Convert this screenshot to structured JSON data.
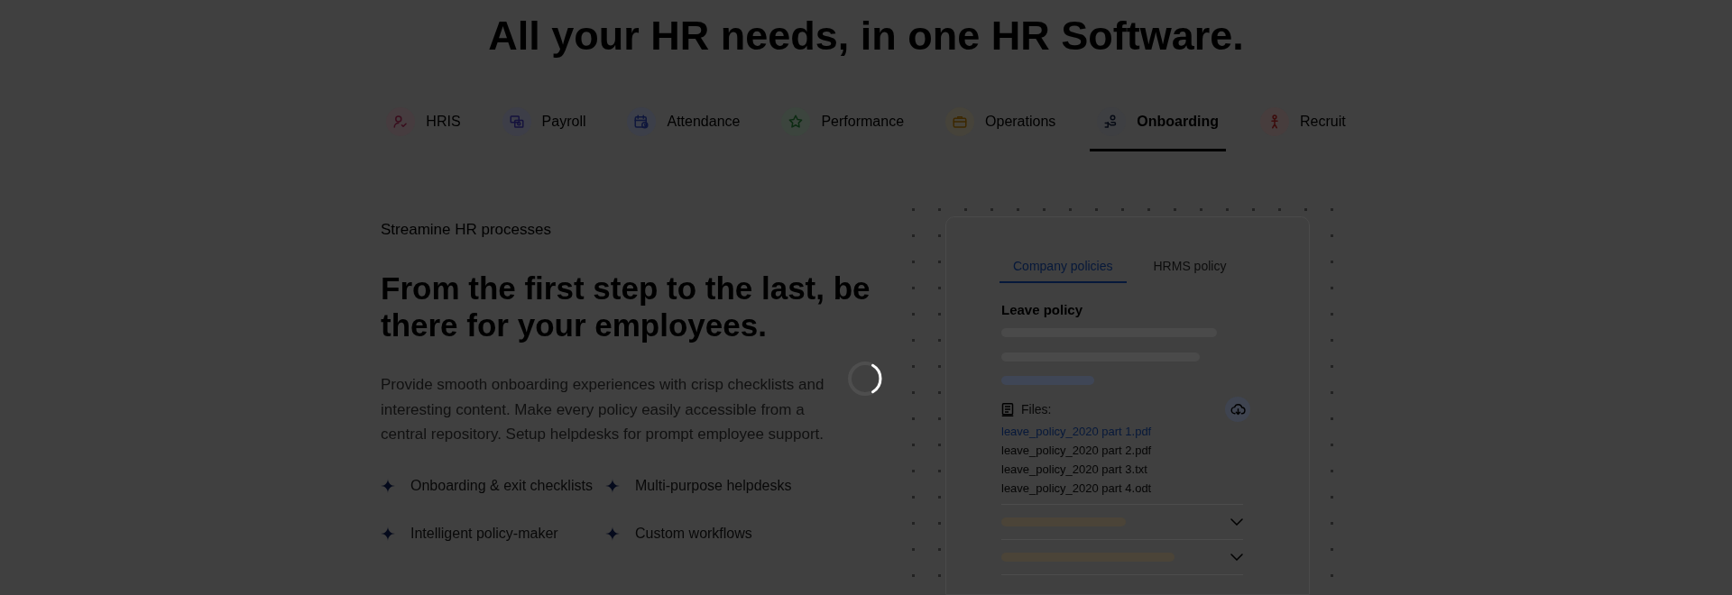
{
  "heading": "All your HR needs, in one HR Software.",
  "product_tabs": [
    {
      "label": "HRIS",
      "selected": false
    },
    {
      "label": "Payroll",
      "selected": false
    },
    {
      "label": "Attendance",
      "selected": false
    },
    {
      "label": "Performance",
      "selected": false
    },
    {
      "label": "Operations",
      "selected": false
    },
    {
      "label": "Onboarding",
      "selected": true
    },
    {
      "label": "Recruit",
      "selected": false
    }
  ],
  "feature": {
    "eyebrow": "Streamine HR processes",
    "title": "From the first step to the last, be there for your employees.",
    "description": "Provide smooth onboarding experiences with crisp checklists and interesting content. Make every policy easily accessible from a central repository. Setup helpdesks for prompt employee support.",
    "highlights": [
      "Onboarding & exit checklists",
      "Multi-purpose helpdesks",
      "Intelligent policy-maker",
      "Custom workflows"
    ]
  },
  "preview": {
    "tabs": [
      {
        "label": "Company policies",
        "selected": true
      },
      {
        "label": "HRMS policy",
        "selected": false
      }
    ],
    "section_title": "Leave policy",
    "files_label": "Files:",
    "files": [
      {
        "name": "leave_policy_2020 part 1.pdf",
        "selected": true
      },
      {
        "name": "leave_policy_2020 part 2.pdf",
        "selected": false
      },
      {
        "name": "leave_policy_2020 part 3.txt",
        "selected": false
      },
      {
        "name": "leave_policy_2020 part 4.odt",
        "selected": false
      }
    ],
    "accordions": [
      {
        "expanded": false
      },
      {
        "expanded": false
      }
    ]
  },
  "loading": true
}
